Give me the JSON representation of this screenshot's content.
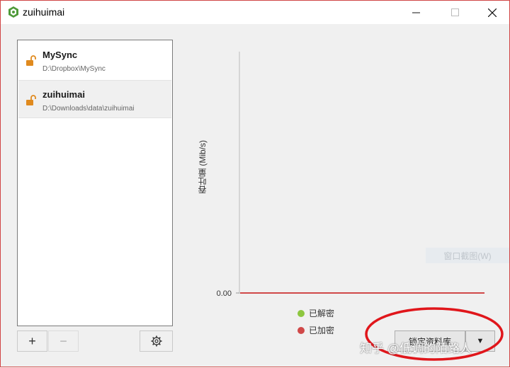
{
  "window": {
    "title": "zuihuimai"
  },
  "sidebar": {
    "items": [
      {
        "name": "MySync",
        "path": "D:\\Dropbox\\MySync",
        "icon": "unlocked-padlock-icon"
      },
      {
        "name": "zuihuimai",
        "path": "D:\\Downloads\\data\\zuihuimai",
        "icon": "unlocked-padlock-icon"
      }
    ],
    "add_label": "+",
    "remove_label": "−"
  },
  "chart_data": {
    "type": "line",
    "ylabel": "吞吐量 (Mib/s)",
    "xlabel": "",
    "y_ticks": [
      "0.00"
    ],
    "series": [
      {
        "name": "已解密",
        "color": "#8dc63f",
        "values": [
          0,
          0
        ]
      },
      {
        "name": "已加密",
        "color": "#d04848",
        "values": [
          0,
          0
        ]
      }
    ]
  },
  "overlay": {
    "window_screenshot_label": "窗口截图(W)"
  },
  "actions": {
    "lock_label": "锁定资料库",
    "dropdown_label": "▼"
  },
  "annotation": {
    "watermark": "知乎 @低调的陌路人",
    "circle_color": "#e0161b"
  }
}
